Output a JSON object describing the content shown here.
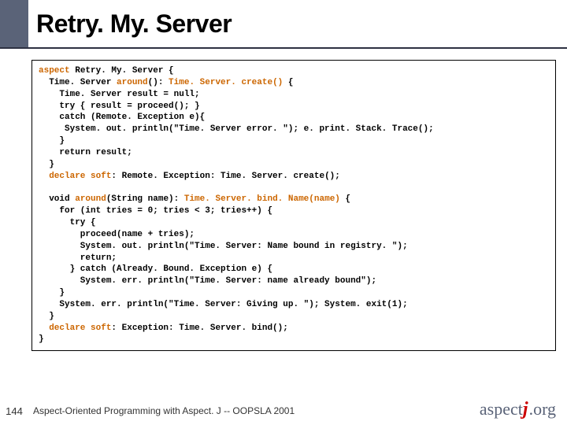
{
  "title": "Retry. My. Server",
  "code": {
    "l01a": "aspect ",
    "l01b": "Retry. My. Server {",
    "l02a": "  Time. Server ",
    "l02b": "around",
    "l02c": "(): ",
    "l02d": "Time. Server. create()",
    "l02e": " {",
    "l03": "    Time. Server result = null;",
    "l04": "    try { result = proceed(); }",
    "l05": "    catch (Remote. Exception e){",
    "l06": "     System. out. println(\"Time. Server error. \"); e. print. Stack. Trace();",
    "l07": "    }",
    "l08": "    return result;",
    "l09": "  }",
    "l10a": "  declare ",
    "l10b": "soft",
    "l10c": ": Remote. Exception: Time. Server. create();",
    "blank1": " ",
    "l11a": "  void ",
    "l11b": "around",
    "l11c": "(String name): ",
    "l11d": "Time. Server. bind. Name(name)",
    "l11e": " {",
    "l12": "    for (int tries = 0; tries < 3; tries++) {",
    "l13": "      try {",
    "l14": "        proceed(name + tries);",
    "l15": "        System. out. println(\"Time. Server: Name bound in registry. \");",
    "l16": "        return;",
    "l17": "      } catch (Already. Bound. Exception e) {",
    "l18": "        System. err. println(\"Time. Server: name already bound\");",
    "l19": "    }",
    "l20": "    System. err. println(\"Time. Server: Giving up. \"); System. exit(1);",
    "l21": "  }",
    "l22a": "  declare ",
    "l22b": "soft",
    "l22c": ": Exception: Time. Server. bind();",
    "l23": "}"
  },
  "page_number": "144",
  "footer_text": "Aspect-Oriented Programming with Aspect. J -- OOPSLA 2001",
  "logo": {
    "aspect": "aspect",
    "j": "j",
    "org": ".org"
  }
}
